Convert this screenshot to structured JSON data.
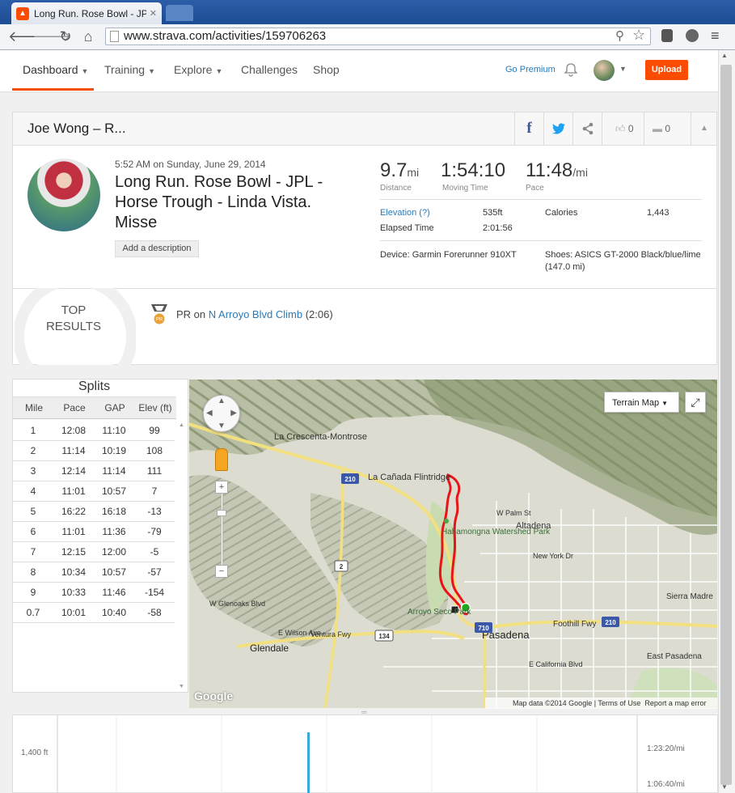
{
  "browser": {
    "tab_title": "Long Run. Rose Bowl - JPL",
    "url": "www.strava.com/activities/159706263"
  },
  "nav": {
    "items": [
      "Dashboard",
      "Training",
      "Explore",
      "Challenges",
      "Shop"
    ],
    "go_premium": "Go Premium",
    "upload": "Upload"
  },
  "header": {
    "athlete": "Joe Wong – R...",
    "kudos": "0",
    "comments": "0"
  },
  "activity": {
    "date": "5:52 AM on Sunday, June 29, 2014",
    "title": "Long Run. Rose Bowl - JPL - Horse Trough - Linda Vista. Misse",
    "add_description": "Add a description",
    "distance_value": "9.7",
    "distance_unit": "mi",
    "distance_label": "Distance",
    "moving_time": "1:54:10",
    "moving_time_label": "Moving Time",
    "pace_value": "11:48",
    "pace_unit": "/mi",
    "pace_label": "Pace",
    "elevation_label": "Elevation (?)",
    "elevation": "535ft",
    "calories_label": "Calories",
    "calories": "1,443",
    "elapsed_label": "Elapsed Time",
    "elapsed": "2:01:56",
    "device": "Device: Garmin Forerunner 910XT",
    "shoes": "Shoes: ASICS GT-2000 Black/blue/lime",
    "shoes_dist": "(147.0 mi)"
  },
  "top_results": {
    "title_line1": "TOP",
    "title_line2": "RESULTS",
    "pr_prefix": "PR on ",
    "segment": "N Arroyo Blvd Climb",
    "time": "(2:06)",
    "badge": "PR"
  },
  "splits": {
    "title": "Splits",
    "columns": [
      "Mile",
      "Pace",
      "GAP",
      "Elev (ft)"
    ],
    "rows": [
      [
        "1",
        "12:08",
        "11:10",
        "99"
      ],
      [
        "2",
        "11:14",
        "10:19",
        "108"
      ],
      [
        "3",
        "12:14",
        "11:14",
        "111"
      ],
      [
        "4",
        "11:01",
        "10:57",
        "7"
      ],
      [
        "5",
        "16:22",
        "16:18",
        "-13"
      ],
      [
        "6",
        "11:01",
        "11:36",
        "-79"
      ],
      [
        "7",
        "12:15",
        "12:00",
        "-5"
      ],
      [
        "8",
        "10:34",
        "10:57",
        "-57"
      ],
      [
        "9",
        "10:33",
        "11:46",
        "-154"
      ],
      [
        "0.7",
        "10:01",
        "10:40",
        "-58"
      ]
    ]
  },
  "map": {
    "type_button": "Terrain Map",
    "labels": [
      "La Crescenta-Montrose",
      "La Cañada Flintridge",
      "Hahamongna Watershed Park",
      "Altadena",
      "Pasadena",
      "Arroyo Seco Park",
      "Glendale",
      "East Pasadena",
      "Sierra Madre",
      "Foothill Fwy",
      "Ventura Fwy",
      "New York Dr",
      "W Palm St",
      "E California Blvd",
      "E Wilson Ave",
      "W Glenoaks Blvd"
    ],
    "shields": [
      "210",
      "2",
      "134",
      "710",
      "210"
    ],
    "data_credit": "Map data ©2014 Google",
    "terms": "Terms of Use",
    "report": "Report a map error",
    "logo": "Google"
  },
  "elevation_chart": {
    "y_label": "1,400 ft",
    "pace_label1": "1:23:20/mi",
    "pace_label2": "1:06:40/mi"
  }
}
